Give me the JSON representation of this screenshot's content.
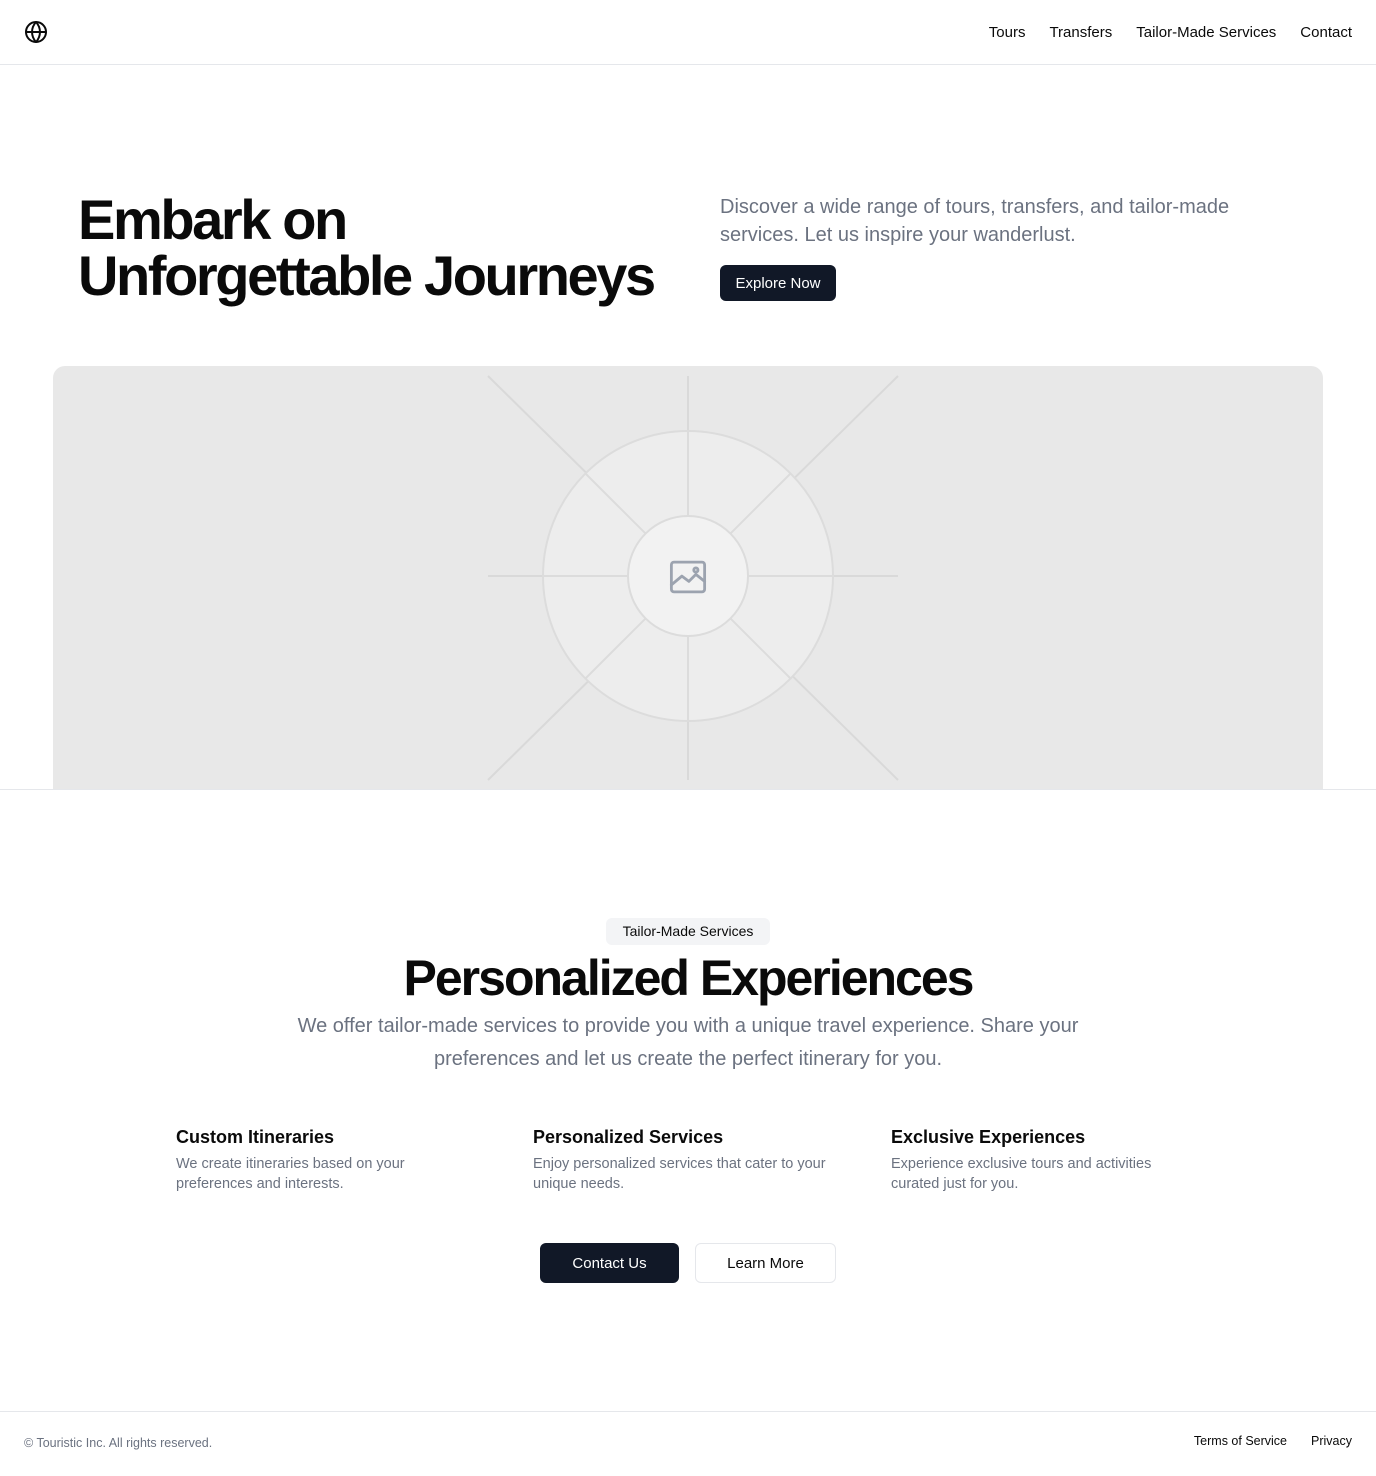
{
  "header": {
    "logo_icon": "globe-icon",
    "nav": [
      {
        "label": "Tours"
      },
      {
        "label": "Transfers"
      },
      {
        "label": "Tailor-Made Services"
      },
      {
        "label": "Contact"
      }
    ]
  },
  "hero": {
    "title_line1": "Embark on",
    "title_line2": "Unforgettable Journeys",
    "description": "Discover a wide range of tours, transfers, and tailor-made services. Let us inspire your wanderlust.",
    "cta_label": "Explore Now",
    "image_icon": "image-placeholder-icon"
  },
  "services": {
    "badge": "Tailor-Made Services",
    "title": "Personalized Experiences",
    "description": "We offer tailor-made services to provide you with a unique travel experience. Share your preferences and let us create the perfect itinerary for you.",
    "features": [
      {
        "title": "Custom Itineraries",
        "text": "We create itineraries based on your preferences and interests."
      },
      {
        "title": "Personalized Services",
        "text": "Enjoy personalized services that cater to your unique needs."
      },
      {
        "title": "Exclusive Experiences",
        "text": "Experience exclusive tours and activities curated just for you."
      }
    ],
    "primary_button": "Contact Us",
    "secondary_button": "Learn More"
  },
  "footer": {
    "copyright": "© Touristic Inc. All rights reserved.",
    "links": [
      {
        "label": "Terms of Service"
      },
      {
        "label": "Privacy"
      }
    ]
  },
  "colors": {
    "primary_dark": "#111827",
    "muted_text": "#6b7280",
    "border": "#e5e7eb",
    "placeholder_bg": "#e8e8e8"
  }
}
